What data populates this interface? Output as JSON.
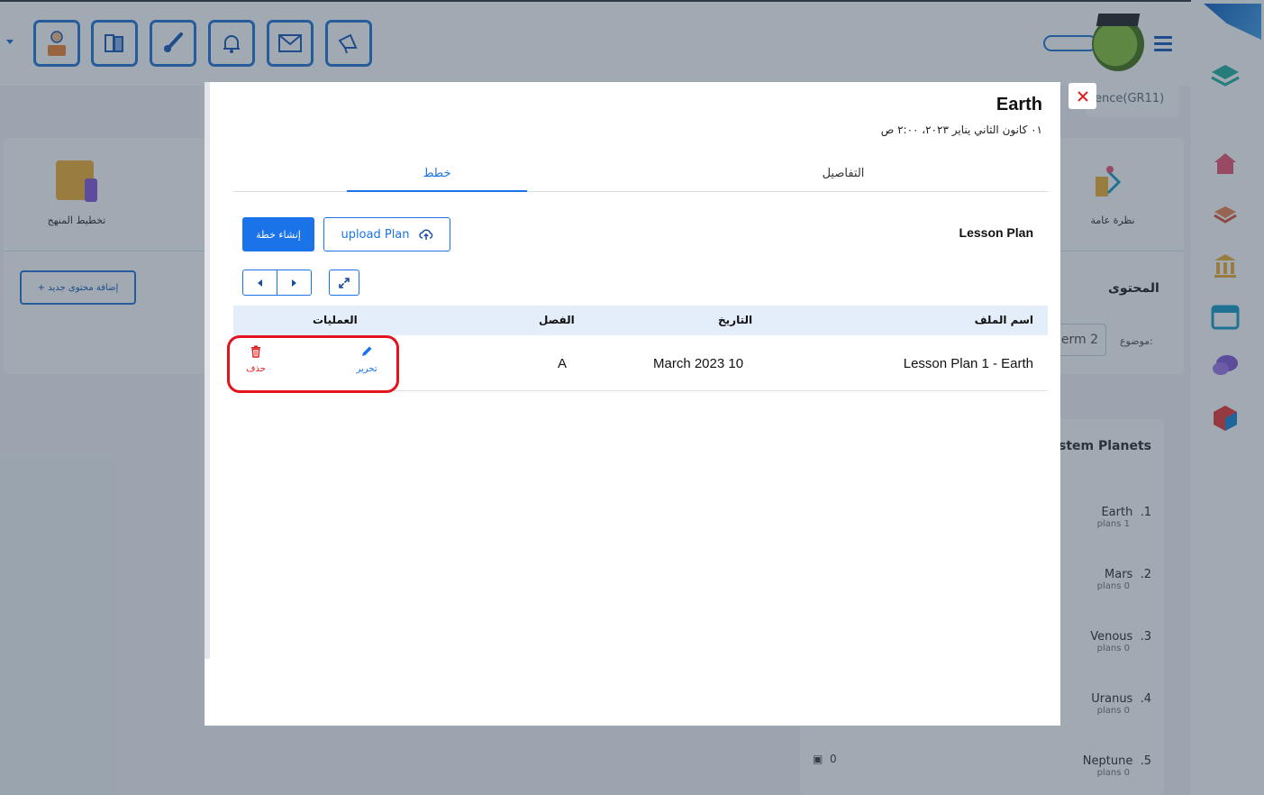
{
  "background": {
    "toolbar_icons": [
      "teacher-icon",
      "books-icon",
      "brush-icon",
      "bell-icon",
      "mail-icon",
      "megaphone-icon"
    ],
    "course_pill": "ence(GR11)",
    "plan_label": "تخطيط المنهج",
    "overview_label": "نظرة عامة",
    "add_content_button": "+ إضافة محتوى جديد",
    "content_title": "المحتوى",
    "topic_label": "موضوع:",
    "term_value": "erm 2",
    "planets_title": "ystem Planets",
    "planets": [
      {
        "num": ".1",
        "name": "Earth",
        "count": "plans 1"
      },
      {
        "num": ".2",
        "name": "Mars",
        "count": "plans 0"
      },
      {
        "num": ".3",
        "name": "Venous",
        "count": "plans 0"
      },
      {
        "num": ".4",
        "name": "Uranus",
        "count": "plans 0"
      },
      {
        "num": ".5",
        "name": "Neptune",
        "count": "plans 0"
      }
    ],
    "planets_footer_count": "0"
  },
  "modal": {
    "title": "Earth",
    "date": "٠١ كانون الثاني يناير ٢٠٢٣، ٢:٠٠ ص",
    "tabs": {
      "plans": "خطط",
      "details": "التفاصيل"
    },
    "section_label": "Lesson Plan",
    "create_button": "إنشاء خطة",
    "upload_button": "upload Plan",
    "table": {
      "headers": {
        "file_name": "اسم الملف",
        "date": "التاريخ",
        "class": "الفصل",
        "operations": "العمليات"
      },
      "rows": [
        {
          "file_name": "Lesson Plan 1 - Earth",
          "date": "March 2023 10",
          "class": "A",
          "edit_label": "تحرير",
          "delete_label": "حذف"
        }
      ]
    }
  },
  "colors": {
    "accent": "#1a73e8",
    "danger": "#e02020",
    "highlight": "#e3141d"
  }
}
